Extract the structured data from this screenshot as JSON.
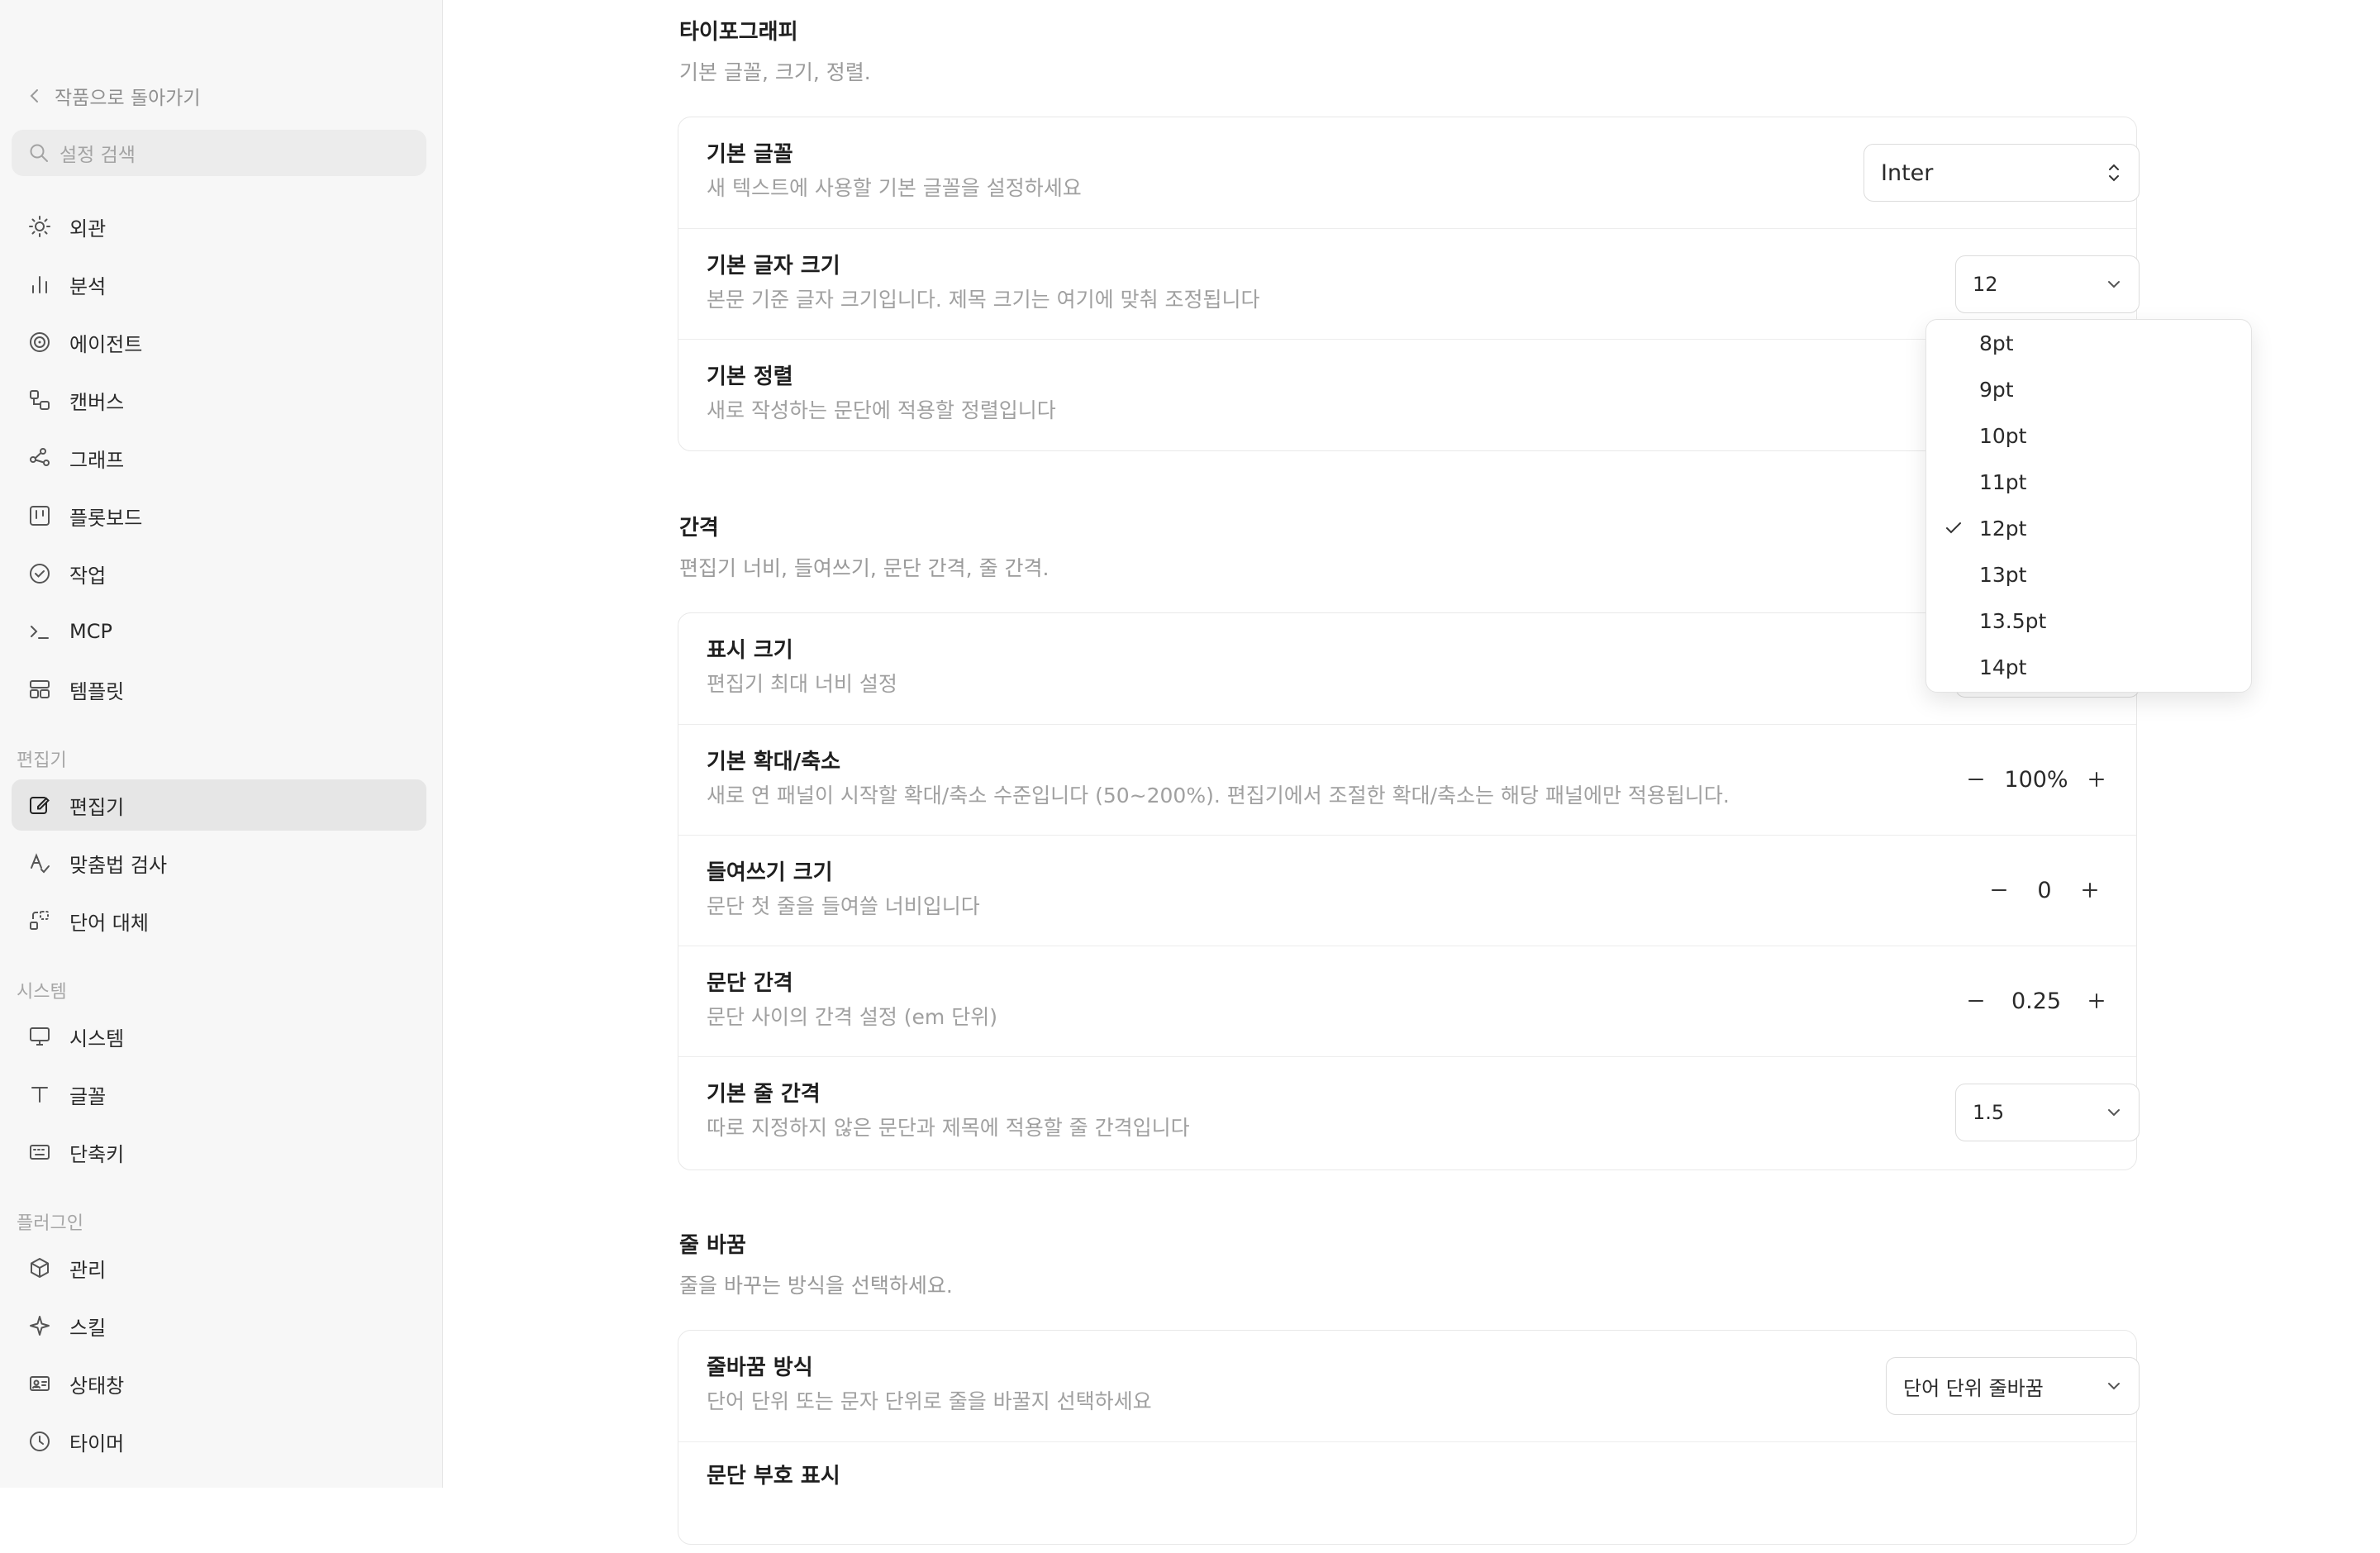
{
  "sidebar": {
    "back_label": "작품으로 돌아가기",
    "search_placeholder": "설정 검색",
    "items": [
      {
        "label": "외관",
        "icon": "sun-icon"
      },
      {
        "label": "분석",
        "icon": "bar-chart-icon"
      },
      {
        "label": "에이전트",
        "icon": "spiral-icon"
      },
      {
        "label": "캔버스",
        "icon": "canvas-icon"
      },
      {
        "label": "그래프",
        "icon": "graph-icon"
      },
      {
        "label": "플롯보드",
        "icon": "board-icon"
      },
      {
        "label": "작업",
        "icon": "check-circle-icon"
      },
      {
        "label": "MCP",
        "icon": "terminal-icon"
      },
      {
        "label": "템플릿",
        "icon": "template-icon"
      }
    ],
    "editor_section": "편집기",
    "editor_items": [
      {
        "label": "편집기",
        "icon": "edit-icon",
        "active": true
      },
      {
        "label": "맞춤법 검사",
        "icon": "spellcheck-icon"
      },
      {
        "label": "단어 대체",
        "icon": "replace-icon"
      }
    ],
    "system_section": "시스템",
    "system_items": [
      {
        "label": "시스템",
        "icon": "monitor-icon"
      },
      {
        "label": "글꼴",
        "icon": "type-icon"
      },
      {
        "label": "단축키",
        "icon": "keyboard-icon"
      }
    ],
    "plugin_section": "플러그인",
    "plugin_items": [
      {
        "label": "관리",
        "icon": "package-icon"
      },
      {
        "label": "스킬",
        "icon": "sparkle-icon"
      },
      {
        "label": "상태창",
        "icon": "id-card-icon"
      },
      {
        "label": "타이머",
        "icon": "clock-icon"
      }
    ]
  },
  "typography": {
    "title": "타이포그래피",
    "desc": "기본 글꼴, 크기, 정렬.",
    "font": {
      "title": "기본 글꼴",
      "desc": "새 텍스트에 사용할 기본 글꼴을 설정하세요",
      "value": "Inter"
    },
    "size": {
      "title": "기본 글자 크기",
      "desc": "본문 기준 글자 크기입니다. 제목 크기는 여기에 맞춰 조정됩니다",
      "value": "12"
    },
    "align": {
      "title": "기본 정렬",
      "desc": "새로 작성하는 문단에 적용할 정렬입니다"
    }
  },
  "spacing": {
    "title": "간격",
    "desc": "편집기 너비, 들여쓰기, 문단 간격, 줄 간격.",
    "display": {
      "title": "표시 크기",
      "desc": "편집기 최대 너비 설정"
    },
    "zoom": {
      "title": "기본 확대/축소",
      "desc": "새로 연 패널이 시작할 확대/축소 수준입니다 (50~200%). 편집기에서 조절한 확대/축소는 해당 패널에만 적용됩니다.",
      "value": "100%"
    },
    "indent": {
      "title": "들여쓰기 크기",
      "desc": "문단 첫 줄을 들여쓸 너비입니다",
      "value": "0"
    },
    "paragraph": {
      "title": "문단 간격",
      "desc": "문단 사이의 간격 설정 (em 단위)",
      "value": "0.25"
    },
    "line": {
      "title": "기본 줄 간격",
      "desc": "따로 지정하지 않은 문단과 제목에 적용할 줄 간격입니다",
      "value": "1.5"
    }
  },
  "wrap": {
    "title": "줄 바꿈",
    "desc": "줄을 바꾸는 방식을 선택하세요.",
    "mode": {
      "title": "줄바꿈 방식",
      "desc": "단어 단위 또는 문자 단위로 줄을 바꿀지 선택하세요",
      "value": "단어 단위 줄바꿈"
    },
    "mark": {
      "title": "문단 부호 표시"
    }
  },
  "dropdown": {
    "options": [
      "8pt",
      "9pt",
      "10pt",
      "11pt",
      "12pt",
      "13pt",
      "13.5pt",
      "14pt"
    ],
    "selected": "12pt"
  }
}
